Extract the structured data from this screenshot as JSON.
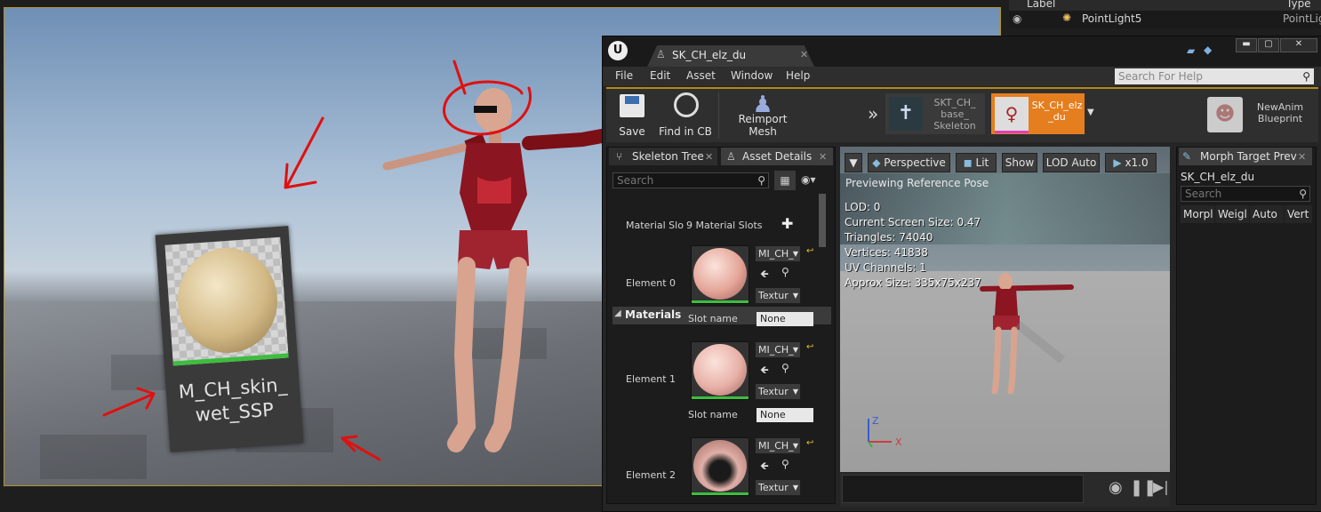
{
  "outliner": {
    "col_label": "Label",
    "col_type": "Type",
    "row_label": "PointLight5",
    "row_type": "PointLig"
  },
  "thumbnail": {
    "line1": "M_CH_skin_",
    "line2": "wet_SSP"
  },
  "editor": {
    "doc_tab": "SK_CH_elz_du",
    "menu": [
      "File",
      "Edit",
      "Asset",
      "Window",
      "Help"
    ],
    "help_search_placeholder": "Search For Help",
    "toolbar": {
      "save": "Save",
      "find_in_cb": "Find in CB",
      "reimport": "Reimport Mesh"
    },
    "mode_tabs": {
      "skeleton_l1": "SKT_CH_",
      "skeleton_l2": "base_",
      "skeleton_l3": "Skeleton",
      "mesh_l1": "SK_CH_elz",
      "mesh_l2": "_du",
      "anim_l1": "NewAnim",
      "anim_l2": "Blueprint"
    }
  },
  "details": {
    "tab_skeleton_tree": "Skeleton Tree",
    "tab_asset_details": "Asset Details",
    "search_placeholder": "Search",
    "materials_header": "Materials",
    "material_slots_label": "Material Slo",
    "material_slots_value": "9 Material Slots",
    "elements": [
      {
        "label": "Element 0",
        "mi": "MI_CH_",
        "tex": "Textur",
        "slot_name_label": "Slot name",
        "slot_name": "None"
      },
      {
        "label": "Element 1",
        "mi": "MI_CH_",
        "tex": "Textur",
        "slot_name_label": "Slot name",
        "slot_name": "None"
      },
      {
        "label": "Element 2",
        "mi": "MI_CH_",
        "tex": "Textur"
      }
    ]
  },
  "preview": {
    "perspective": "Perspective",
    "lit": "Lit",
    "show": "Show",
    "lod": "LOD Auto",
    "speed": "x1.0",
    "banner": "Previewing Reference Pose",
    "stats": [
      "LOD: 0",
      "Current Screen Size: 0.47",
      "Triangles: 74040",
      "Vertices: 41838",
      "UV Channels: 1",
      "Approx Size: 335x75x237"
    ],
    "axis_z": "Z",
    "axis_x": "X"
  },
  "morph": {
    "tab": "Morph Target Prev",
    "asset": "SK_CH_elz_du",
    "search_placeholder": "Search",
    "columns": [
      "Morpl",
      "Weigl",
      "Auto",
      "Vert C"
    ]
  },
  "colors": {
    "accent_orange": "#e57e1e",
    "green_bar": "#3ebd3e",
    "annotation_red": "#e01010"
  }
}
